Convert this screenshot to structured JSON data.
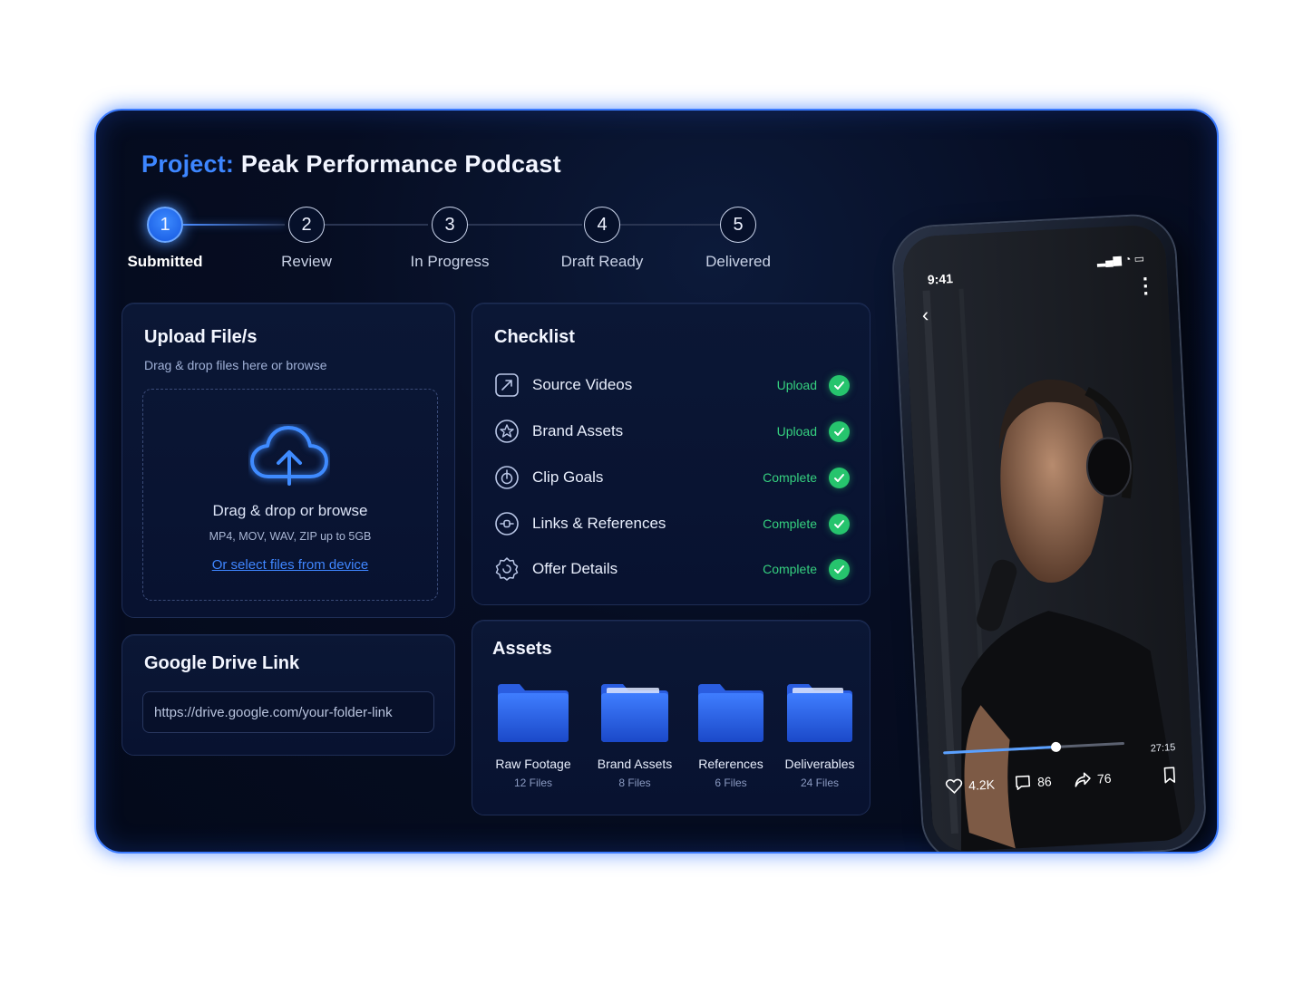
{
  "project": {
    "prefix": "Project:",
    "name": "Peak Performance Podcast"
  },
  "steps": [
    {
      "number": "1",
      "label": "Submitted"
    },
    {
      "number": "2",
      "label": "Review"
    },
    {
      "number": "3",
      "label": "In Progress"
    },
    {
      "number": "4",
      "label": "Draft Ready"
    },
    {
      "number": "5",
      "label": "Delivered"
    }
  ],
  "upload": {
    "title": "Upload File/s",
    "subtitle": "Drag & drop files here or browse",
    "drop_main": "Drag & drop or browse",
    "drop_formats": "MP4, MOV, WAV, ZIP up to 5GB",
    "select_link": "Or select files from device"
  },
  "gdrive": {
    "title": "Google Drive Link",
    "value": "https://drive.google.com/your-folder-link"
  },
  "checklist": {
    "title": "Checklist",
    "items": [
      {
        "label": "Source Videos",
        "status": "Upload",
        "icon": "video-upload-icon"
      },
      {
        "label": "Brand Assets",
        "status": "Upload",
        "icon": "brand-icon"
      },
      {
        "label": "Clip Goals",
        "status": "Complete",
        "icon": "target-icon"
      },
      {
        "label": "Links & References",
        "status": "Complete",
        "icon": "link-icon"
      },
      {
        "label": "Offer Details",
        "status": "Complete",
        "icon": "offer-icon"
      }
    ]
  },
  "assets": {
    "title": "Assets",
    "folders": [
      {
        "name": "Raw Footage",
        "count": "12 Files"
      },
      {
        "name": "Brand Assets",
        "count": "8 Files"
      },
      {
        "name": "References",
        "count": "6 Files"
      },
      {
        "name": "Deliverables",
        "count": "24 Files"
      }
    ]
  },
  "phone": {
    "time": "9:41",
    "duration": "27:15",
    "progress": 0.62,
    "likes": "4.2K",
    "comments": "86",
    "shares": "76"
  },
  "colors": {
    "accent": "#3d86ff",
    "success": "#26c46d",
    "background": "#060d22"
  }
}
